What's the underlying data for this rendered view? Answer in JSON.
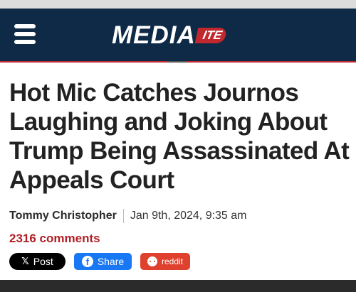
{
  "header": {
    "logo_main": "MEDIA",
    "logo_badge": "ITE",
    "menu_icon": "hamburger-menu-icon",
    "colors": {
      "background": "#0f2a47",
      "accent": "#c0282d"
    }
  },
  "article": {
    "headline": "Hot Mic Catches Journos Laughing and Joking About Trump Being Assassinated At Appeals Court",
    "author": "Tommy Christopher",
    "date": "Jan 9th, 2024, 9:35 am",
    "comments": "2316 comments"
  },
  "share": {
    "x_label": "Post",
    "x_icon": "x-logo-icon",
    "facebook_label": "Share",
    "facebook_icon": "facebook-icon",
    "reddit_label": "reddit",
    "reddit_icon": "reddit-icon",
    "colors": {
      "x": "#000000",
      "facebook": "#1877f2",
      "reddit": "#e0412e"
    }
  }
}
